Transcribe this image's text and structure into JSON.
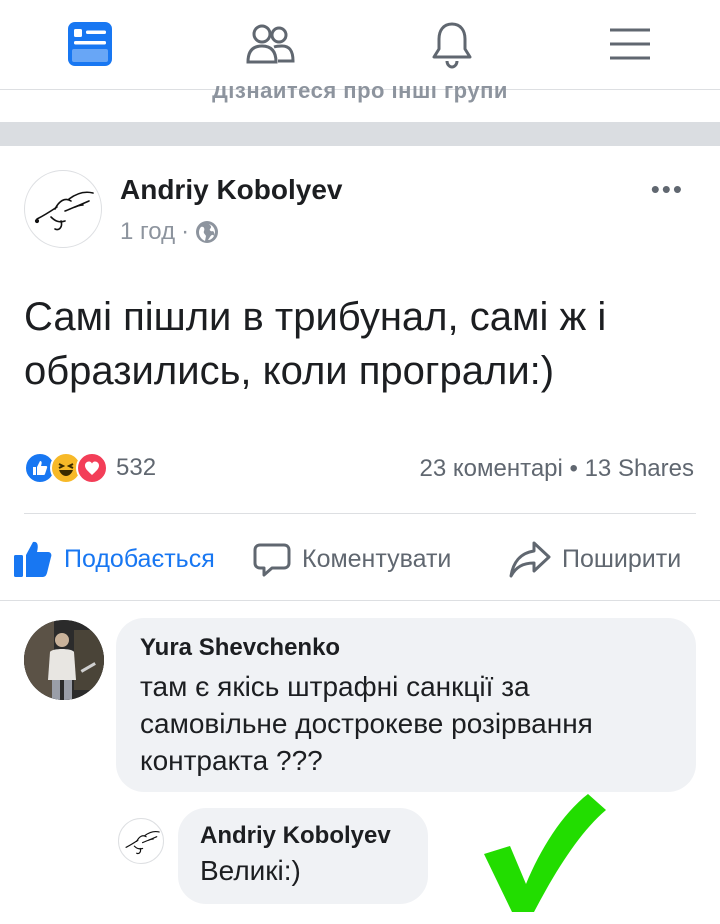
{
  "nav": {
    "items": [
      {
        "name": "news-feed",
        "active": true
      },
      {
        "name": "friends",
        "active": false
      },
      {
        "name": "notifications",
        "active": false
      },
      {
        "name": "menu",
        "active": false
      }
    ],
    "accent": "#1877f2"
  },
  "partial_banner": "Дізнайтеся про інші групи",
  "post": {
    "author": "Andriy Kobolyev",
    "time": "1 год",
    "meta_separator": "·",
    "privacy_icon": "globe-icon",
    "more_label": "•••",
    "text": "Самі пішли в трибунал, самі ж і образились, коли програли:)",
    "reactions": {
      "types": [
        "like",
        "haha",
        "love"
      ],
      "count": "532"
    },
    "stats": "23 коментарі • 13 Shares",
    "actions": {
      "like": "Подобається",
      "comment": "Коментувати",
      "share": "Поширити"
    }
  },
  "comments": [
    {
      "author": "Yura Shevchenko",
      "text": "там є якісь штрафні санкції за самовільне дострокеве розірвання контракта ???"
    },
    {
      "author": "Andriy Kobolyev",
      "text": "Великі:)"
    }
  ],
  "annotation": {
    "type": "check-mark",
    "color": "#22dd00"
  }
}
